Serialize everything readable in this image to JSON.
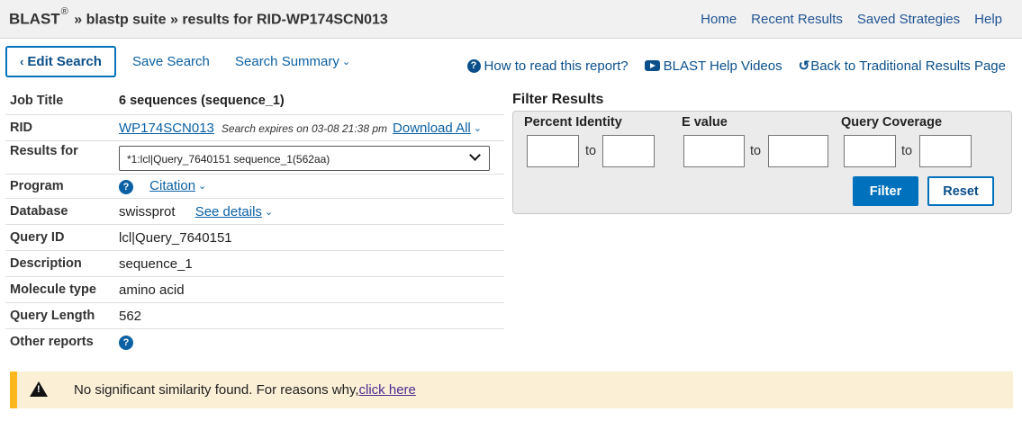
{
  "header": {
    "brand": "BLAST",
    "reg": "®",
    "crumb_sep1": "»",
    "suite": "blastp suite",
    "crumb_sep2": "»",
    "results_label": "results for RID-WP174SCN013",
    "nav": [
      "Home",
      "Recent Results",
      "Saved Strategies",
      "Help"
    ]
  },
  "toolbar": {
    "edit_search": "Edit Search",
    "save_search": "Save Search",
    "search_summary": "Search Summary",
    "how_to_read": "How to read this report?",
    "help_videos": "BLAST Help Videos",
    "back_traditional": "Back to Traditional Results Page"
  },
  "info": {
    "job_title_label": "Job Title",
    "job_title_value": "6 sequences (sequence_1)",
    "rid_label": "RID",
    "rid_value": "WP174SCN013",
    "rid_expiry": "Search expires on 03-08 21:38 pm",
    "download_all": "Download All",
    "results_for_label": "Results for",
    "results_for_value": "*1:lcl|Query_7640151 sequence_1(562aa)",
    "program_label": "Program",
    "citation": "Citation",
    "database_label": "Database",
    "database_value": "swissprot",
    "see_details": "See details",
    "query_id_label": "Query ID",
    "query_id_value": "lcl|Query_7640151",
    "description_label": "Description",
    "description_value": "sequence_1",
    "molecule_type_label": "Molecule type",
    "molecule_type_value": "amino acid",
    "query_length_label": "Query Length",
    "query_length_value": "562",
    "other_reports_label": "Other reports"
  },
  "filter": {
    "title": "Filter Results",
    "percent_identity": "Percent Identity",
    "e_value": "E value",
    "query_coverage": "Query Coverage",
    "to": "to",
    "filter_button": "Filter",
    "reset_button": "Reset"
  },
  "alert": {
    "message": "No significant similarity found. For reasons why,",
    "link": "click here"
  },
  "colors": {
    "link": "#0b61a4",
    "primary_button": "#0071bc",
    "alert_bg": "#fbefd6",
    "alert_border": "#fdb81e"
  }
}
